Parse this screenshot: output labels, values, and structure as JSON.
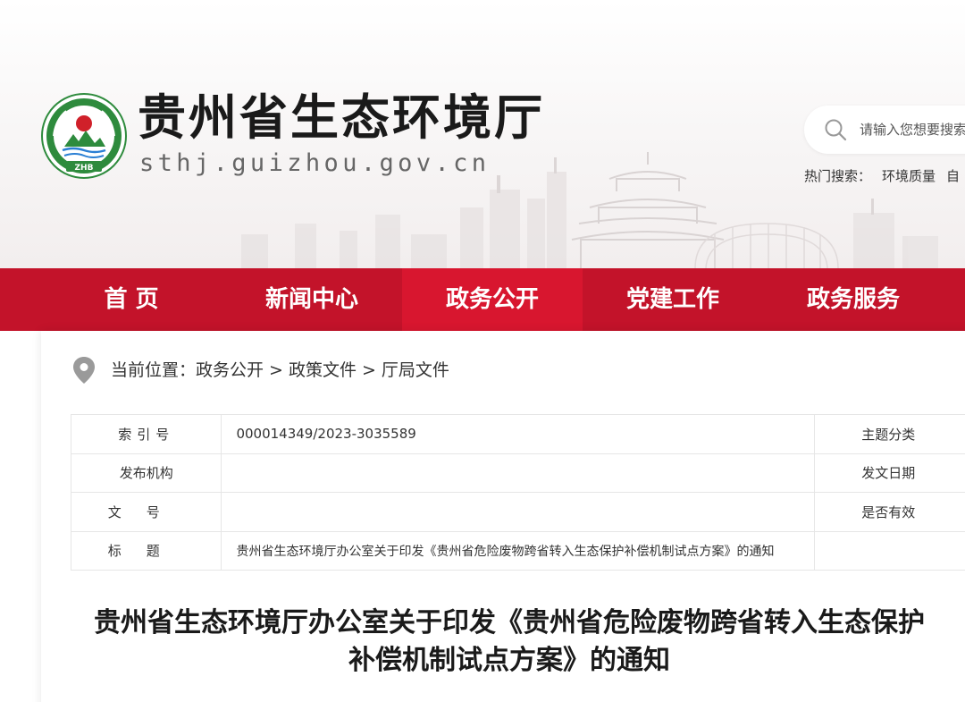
{
  "header": {
    "title": "贵州省生态环境厅",
    "domain": "sthj.guizhou.gov.cn",
    "logo_text": "ZHB"
  },
  "search": {
    "placeholder": "请输入您想要搜索",
    "icon": "search-icon"
  },
  "hot_search": {
    "label": "热门搜索：",
    "items": [
      "环境质量",
      "自"
    ]
  },
  "nav": {
    "items": [
      {
        "label": "首 页",
        "active": false
      },
      {
        "label": "新闻中心",
        "active": false
      },
      {
        "label": "政务公开",
        "active": true
      },
      {
        "label": "党建工作",
        "active": false
      },
      {
        "label": "政务服务",
        "active": false
      }
    ]
  },
  "breadcrumb": {
    "prefix": "当前位置：",
    "items": [
      "政务公开",
      "政策文件",
      "厅局文件"
    ],
    "separator": ">"
  },
  "meta": {
    "rows": [
      {
        "key": "索引号",
        "value": "000014349/2023-3035589",
        "key2": "主题分类"
      },
      {
        "key": "发布机构",
        "value": "",
        "key2": "发文日期"
      },
      {
        "key": "文号",
        "value": "",
        "key2": "是否有效"
      },
      {
        "key": "标题",
        "value": "贵州省生态环境厅办公室关于印发《贵州省危险废物跨省转入生态保护补偿机制试点方案》的通知",
        "key2": ""
      }
    ]
  },
  "article": {
    "title_line1": "贵州省生态环境厅办公室关于印发《贵州省危险废物跨省转入生态保护",
    "title_line2": "补偿机制试点方案》的通知"
  },
  "colors": {
    "nav_bg": "#c3132a",
    "nav_active": "#d8162f",
    "logo_green": "#2e8b3d",
    "logo_red": "#d0202a"
  }
}
